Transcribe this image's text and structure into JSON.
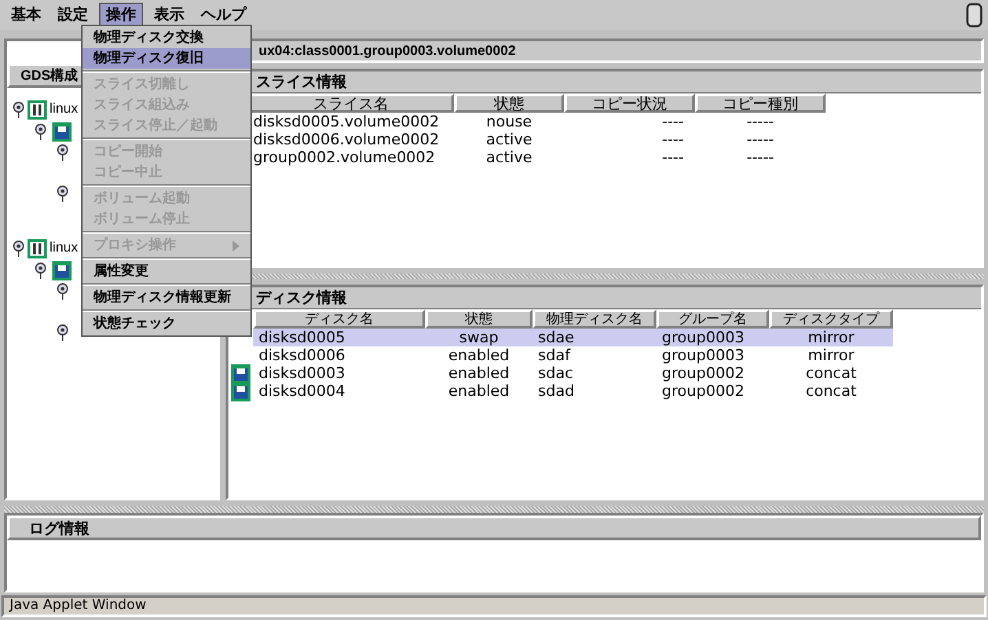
{
  "menubar": [
    {
      "label": "基本",
      "selected": false
    },
    {
      "label": "設定",
      "selected": false
    },
    {
      "label": "操作",
      "selected": true
    },
    {
      "label": "表示",
      "selected": false
    },
    {
      "label": "ヘルプ",
      "selected": false
    }
  ],
  "menu": [
    {
      "kind": "item",
      "label": "物理ディスク交換",
      "disabled": false,
      "selected": false
    },
    {
      "kind": "item",
      "label": "物理ディスク復旧",
      "disabled": false,
      "selected": true
    },
    {
      "kind": "separator"
    },
    {
      "kind": "item",
      "label": "スライス切離し",
      "disabled": true,
      "selected": false
    },
    {
      "kind": "item",
      "label": "スライス組込み",
      "disabled": true,
      "selected": false
    },
    {
      "kind": "item",
      "label": "スライス停止／起動",
      "disabled": true,
      "selected": false
    },
    {
      "kind": "separator"
    },
    {
      "kind": "item",
      "label": "コピー開始",
      "disabled": true,
      "selected": false
    },
    {
      "kind": "item",
      "label": "コピー中止",
      "disabled": true,
      "selected": false
    },
    {
      "kind": "separator"
    },
    {
      "kind": "item",
      "label": "ボリューム起動",
      "disabled": true,
      "selected": false
    },
    {
      "kind": "item",
      "label": "ボリューム停止",
      "disabled": true,
      "selected": false
    },
    {
      "kind": "separator"
    },
    {
      "kind": "submenu",
      "label": "プロキシ操作",
      "disabled": true,
      "selected": false
    },
    {
      "kind": "separator"
    },
    {
      "kind": "item",
      "label": "属性変更",
      "disabled": false,
      "selected": false
    },
    {
      "kind": "separator"
    },
    {
      "kind": "item",
      "label": "物理ディスク情報更新",
      "disabled": false,
      "selected": false
    },
    {
      "kind": "separator"
    },
    {
      "kind": "item",
      "label": "状態チェック",
      "disabled": false,
      "selected": false
    }
  ],
  "left_panel": {
    "title": "GDS構成"
  },
  "tree": [
    {
      "label": "linux",
      "children": [
        {
          "kind": "disk",
          "children": [
            {
              "kind": "volume"
            },
            {
              "kind": "volume"
            }
          ]
        }
      ]
    },
    {
      "label": "linux",
      "children": [
        {
          "kind": "disk",
          "children": [
            {
              "kind": "volume"
            },
            {
              "kind": "volume"
            }
          ]
        }
      ]
    }
  ],
  "path_title": "ux04:class0001.group0003.volume0002",
  "slice_info": {
    "title": "スライス情報",
    "columns": [
      "スライス名",
      "状態",
      "コピー状況",
      "コピー種別"
    ],
    "rows": [
      {
        "cells": [
          "disksd0005.volume0002",
          "nouse",
          "----",
          "-----"
        ]
      },
      {
        "cells": [
          "disksd0006.volume0002",
          "active",
          "----",
          "-----"
        ]
      },
      {
        "cells": [
          "group0002.volume0002",
          "active",
          "----",
          "-----"
        ]
      }
    ]
  },
  "disk_info": {
    "title": "ディスク情報",
    "columns": [
      "ディスク名",
      "状態",
      "物理ディスク名",
      "グループ名",
      "ディスクタイプ"
    ],
    "rows": [
      {
        "selected": true,
        "cells": [
          "disksd0005",
          "swap",
          "sdae",
          "group0003",
          "mirror"
        ]
      },
      {
        "selected": false,
        "cells": [
          "disksd0006",
          "enabled",
          "sdaf",
          "group0003",
          "mirror"
        ]
      },
      {
        "selected": false,
        "cells": [
          "disksd0003",
          "enabled",
          "sdac",
          "group0002",
          "concat"
        ]
      },
      {
        "selected": false,
        "cells": [
          "disksd0004",
          "enabled",
          "sdad",
          "group0002",
          "concat"
        ]
      }
    ]
  },
  "log": {
    "title": "ログ情報"
  },
  "status_bar": "Java Applet Window"
}
